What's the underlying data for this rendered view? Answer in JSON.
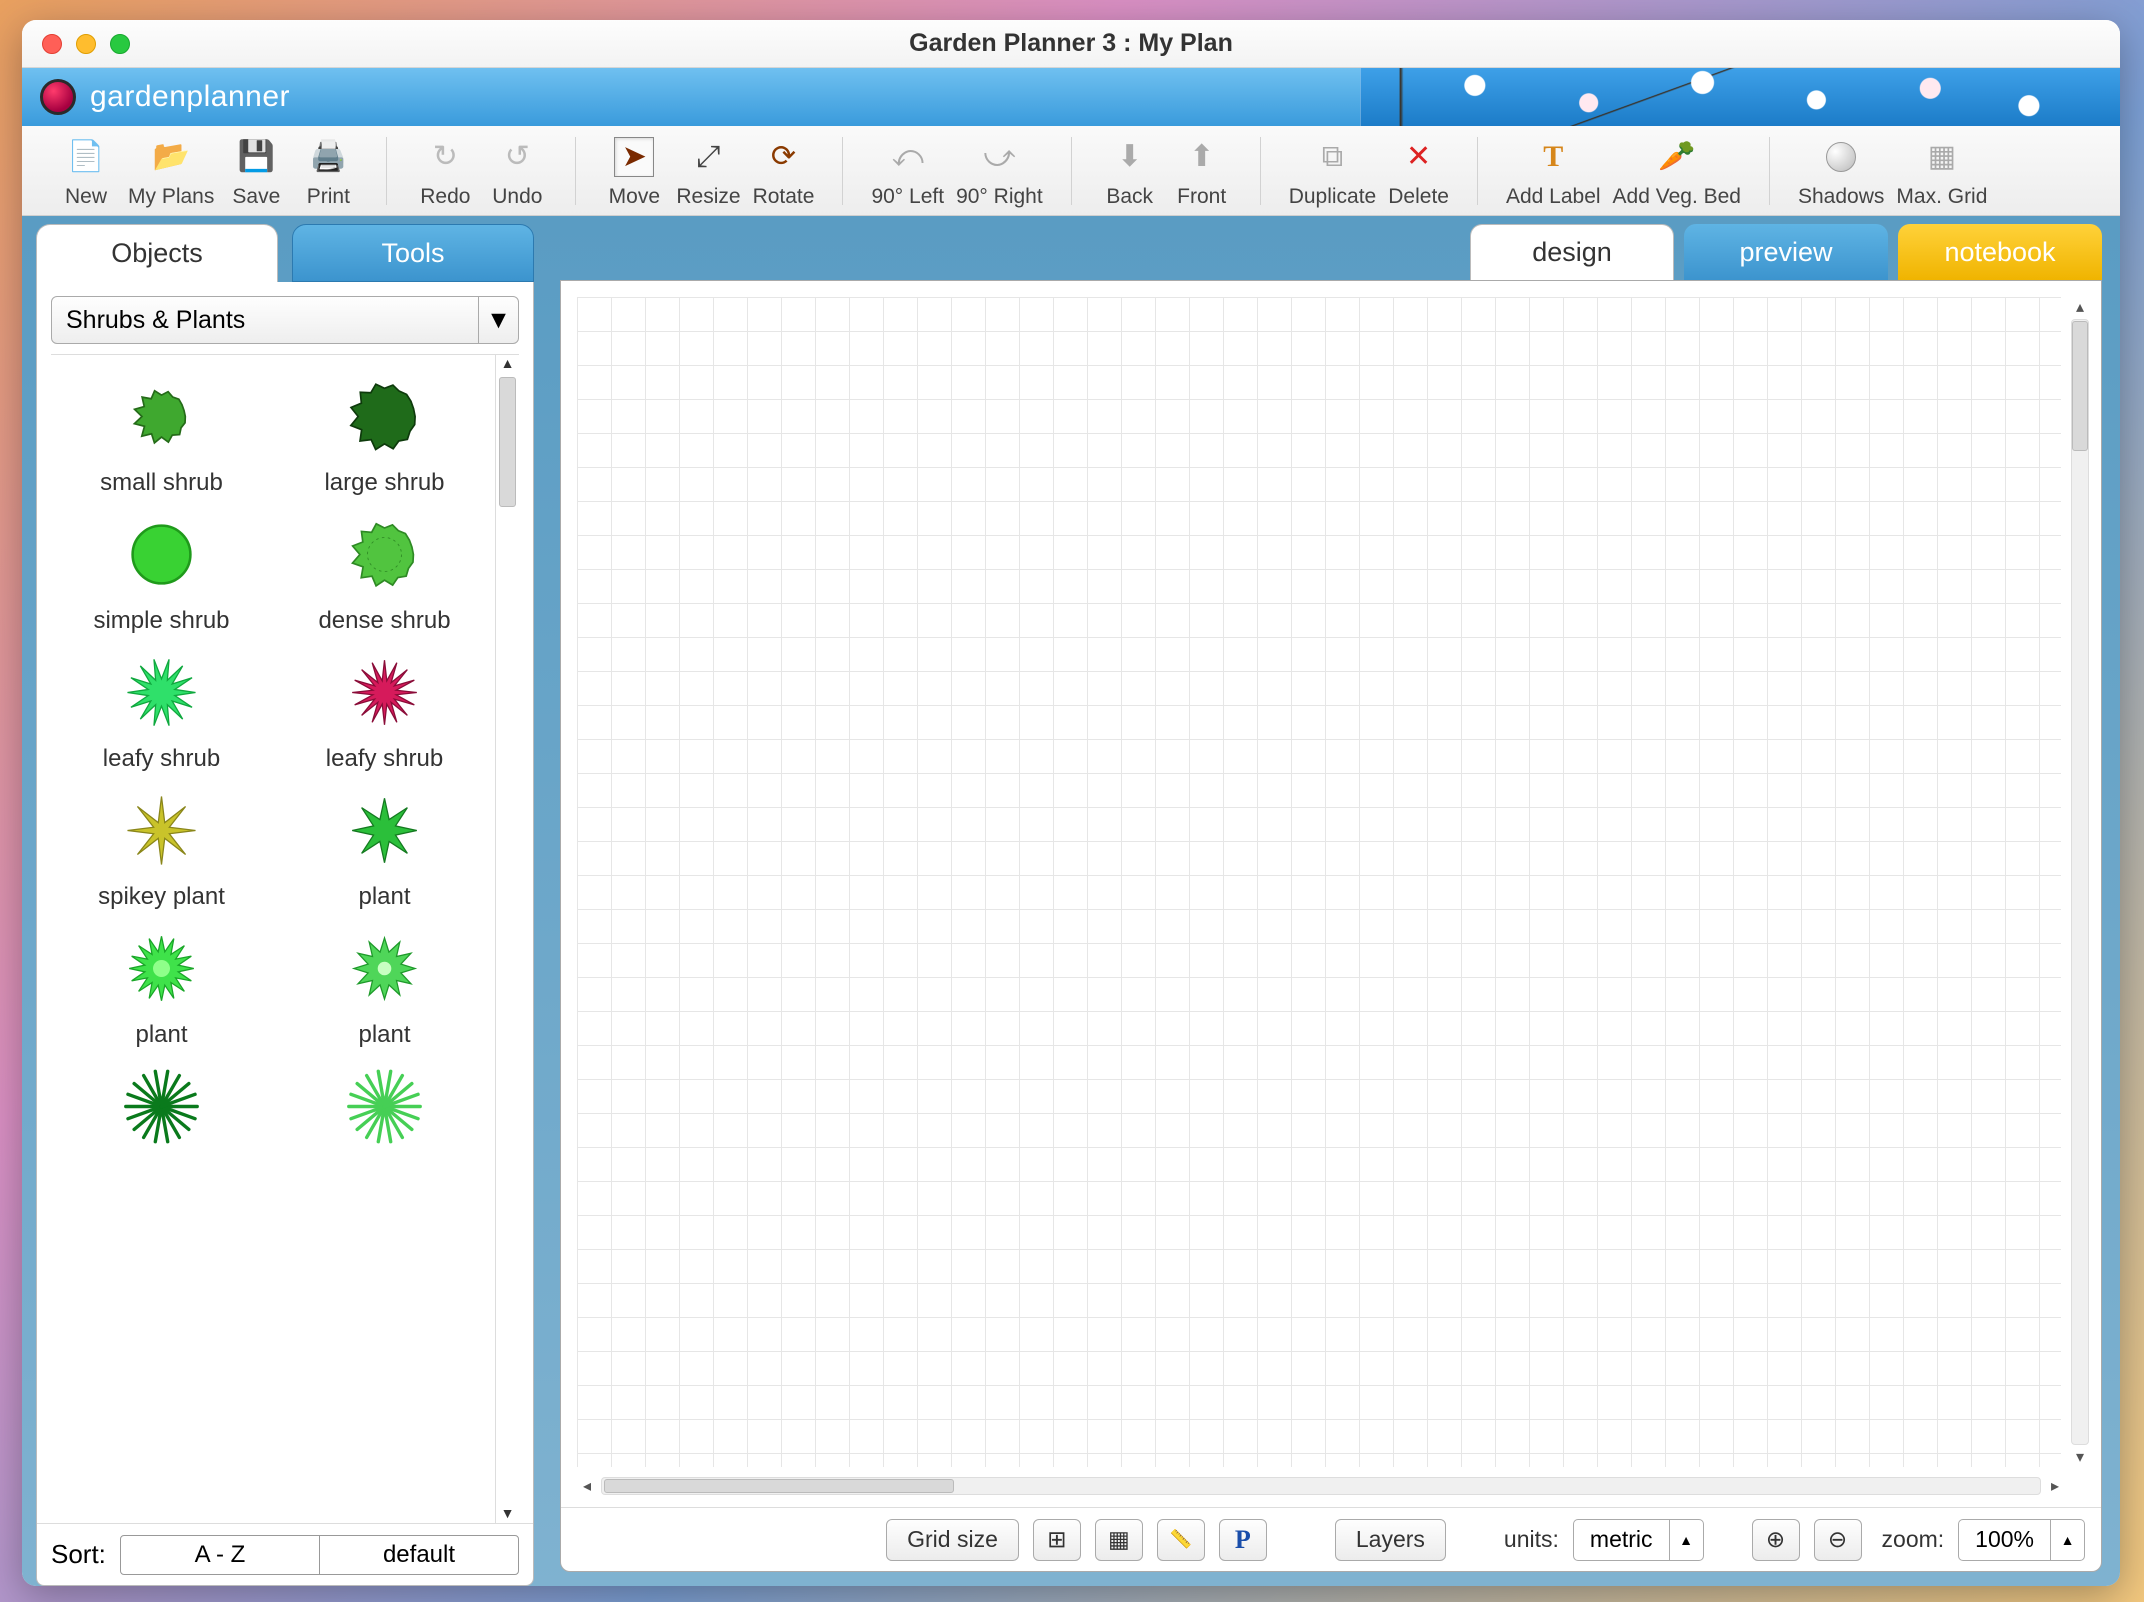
{
  "window": {
    "title": "Garden Planner 3 : My  Plan"
  },
  "brand": {
    "name_light": "garden",
    "name_bold": "planner"
  },
  "toolbar": {
    "new": "New",
    "myplans": "My Plans",
    "save": "Save",
    "print": "Print",
    "redo": "Redo",
    "undo": "Undo",
    "move": "Move",
    "resize": "Resize",
    "rotate": "Rotate",
    "rot_left": "90° Left",
    "rot_right": "90° Right",
    "back": "Back",
    "front": "Front",
    "duplicate": "Duplicate",
    "delete": "Delete",
    "add_label": "Add Label",
    "add_veg": "Add Veg. Bed",
    "shadows": "Shadows",
    "max_grid": "Max. Grid"
  },
  "left_tabs": {
    "objects": "Objects",
    "tools": "Tools"
  },
  "category": {
    "selected": "Shrubs & Plants"
  },
  "objects": [
    {
      "label": "small shrub",
      "icon": "small-shrub"
    },
    {
      "label": "large shrub",
      "icon": "large-shrub"
    },
    {
      "label": "simple shrub",
      "icon": "simple-shrub"
    },
    {
      "label": "dense shrub",
      "icon": "dense-shrub"
    },
    {
      "label": "leafy shrub",
      "icon": "leafy-shrub-green"
    },
    {
      "label": "leafy shrub",
      "icon": "leafy-shrub-red"
    },
    {
      "label": "spikey plant",
      "icon": "spikey-plant"
    },
    {
      "label": "plant",
      "icon": "plant-star"
    },
    {
      "label": "plant",
      "icon": "plant-rosette"
    },
    {
      "label": "plant",
      "icon": "plant-flower"
    },
    {
      "label": "",
      "icon": "grass-clump-dark"
    },
    {
      "label": "",
      "icon": "grass-clump-light"
    }
  ],
  "sort": {
    "label": "Sort:",
    "opt_a": "A - Z",
    "opt_b": "default"
  },
  "right_tabs": {
    "design": "design",
    "preview": "preview",
    "notebook": "notebook"
  },
  "bottombar": {
    "grid_size": "Grid size",
    "layers": "Layers",
    "units_label": "units:",
    "units_value": "metric",
    "zoom_label": "zoom:",
    "zoom_value": "100%",
    "p_glyph": "P"
  }
}
